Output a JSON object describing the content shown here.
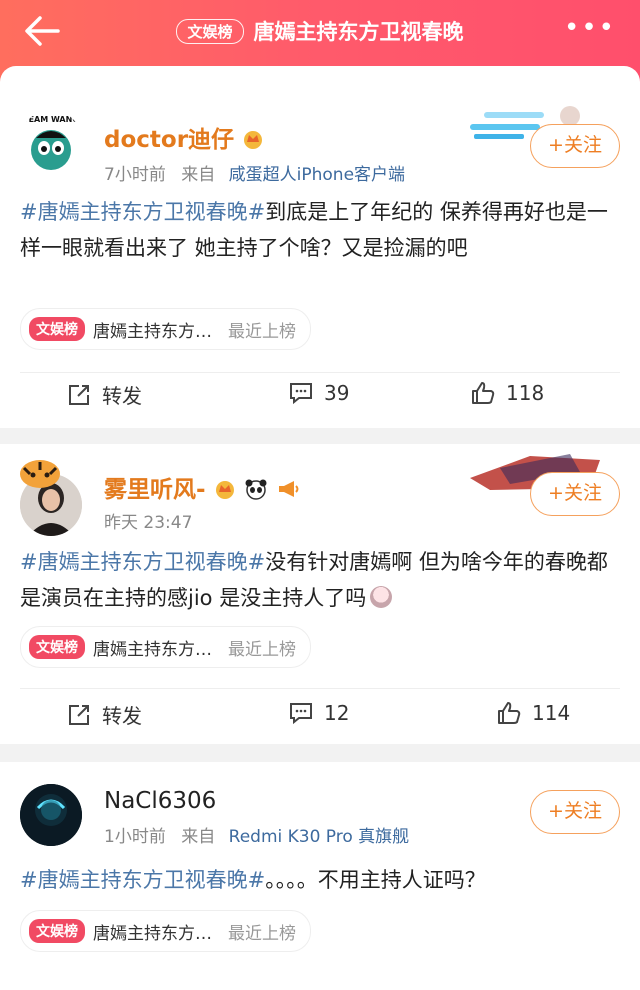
{
  "header": {
    "badge": "文娱榜",
    "title": "唐嫣主持东方卫视春晚",
    "more": "•••"
  },
  "posts": [
    {
      "username": "doctor迪仔",
      "time": "7小时前",
      "from": "来自",
      "source": "咸蛋超人iPhone客户端",
      "follow": "+关注",
      "tag": "#唐嫣主持东方卫视春晚#",
      "text": "到底是上了年纪的 保养得再好也是一样一眼就看出来了  她主持了个啥？又是捡漏的吧",
      "hot_badge": "文娱榜",
      "hot_title": "唐嫣主持东方…",
      "hot_rank": "最近上榜",
      "repost": "转发",
      "comments": "39",
      "likes": "118",
      "avatar_text": "TEAM WANG"
    },
    {
      "username": "雾里听风-",
      "time": "昨天 23:47",
      "follow": "+关注",
      "tag": "#唐嫣主持东方卫视春晚#",
      "text": "没有针对唐嫣啊 但为啥今年的春晚都是演员在主持的感jio 是没主持人了吗",
      "hot_badge": "文娱榜",
      "hot_title": "唐嫣主持东方…",
      "hot_rank": "最近上榜",
      "repost": "转发",
      "comments": "12",
      "likes": "114"
    },
    {
      "username": "NaCl6306",
      "time": "1小时前",
      "from": "来自",
      "source": "Redmi K30 Pro 真旗舰",
      "follow": "+关注",
      "tag": "#唐嫣主持东方卫视春晚#",
      "text": "。。。。不用主持人证吗？",
      "hot_badge": "文娱榜",
      "hot_title": "唐嫣主持东方…",
      "hot_rank": "最近上榜"
    }
  ],
  "colors": {
    "header": "#ff5a6b",
    "tag": "#4b77a8",
    "username_vip": "#e37a1d",
    "follow": "#ee7e23"
  }
}
